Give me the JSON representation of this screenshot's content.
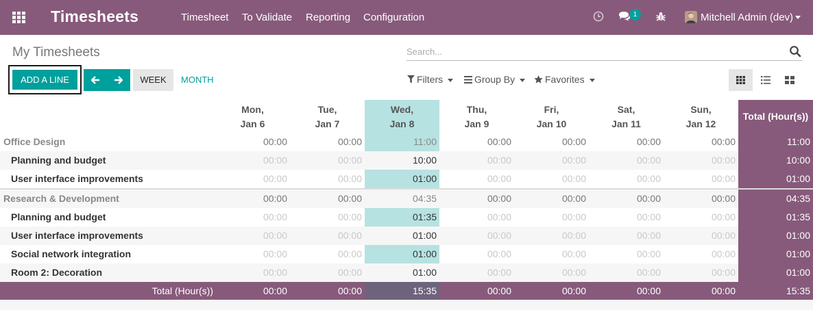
{
  "navbar": {
    "app_title": "Timesheets",
    "menu": [
      "Timesheet",
      "To Validate",
      "Reporting",
      "Configuration"
    ],
    "chat_count": "1",
    "user_name": "Mitchell Admin (dev)",
    "icons": [
      "apps-grid-icon",
      "clock-icon",
      "chat-icon",
      "bug-icon",
      "avatar"
    ],
    "color": "#875a7b"
  },
  "control": {
    "page_title": "My Timesheets",
    "search_placeholder": "Search...",
    "add_line": "ADD A LINE",
    "week": "WEEK",
    "month": "MONTH",
    "filters": "Filters",
    "group_by": "Group By",
    "favorites": "Favorites",
    "accent": "#00a09d"
  },
  "grid": {
    "days": [
      {
        "name": "Mon,",
        "date": "Jan 6"
      },
      {
        "name": "Tue,",
        "date": "Jan 7"
      },
      {
        "name": "Wed,",
        "date": "Jan 8"
      },
      {
        "name": "Thu,",
        "date": "Jan 9"
      },
      {
        "name": "Fri,",
        "date": "Jan 10"
      },
      {
        "name": "Sat,",
        "date": "Jan 11"
      },
      {
        "name": "Sun,",
        "date": "Jan 12"
      }
    ],
    "total_header": "Total (Hour(s))",
    "today_index": 2,
    "rows": [
      {
        "kind": "group",
        "label": "Office Design",
        "values": [
          "00:00",
          "00:00",
          "11:00",
          "00:00",
          "00:00",
          "00:00",
          "00:00"
        ],
        "total": "11:00"
      },
      {
        "kind": "line",
        "label": "Planning and budget",
        "values": [
          "00:00",
          "00:00",
          "10:00",
          "00:00",
          "00:00",
          "00:00",
          "00:00"
        ],
        "total": "10:00"
      },
      {
        "kind": "line",
        "label": "User interface improvements",
        "values": [
          "00:00",
          "00:00",
          "01:00",
          "00:00",
          "00:00",
          "00:00",
          "00:00"
        ],
        "total": "01:00"
      },
      {
        "kind": "group",
        "label": "Research & Development",
        "values": [
          "00:00",
          "00:00",
          "04:35",
          "00:00",
          "00:00",
          "00:00",
          "00:00"
        ],
        "total": "04:35"
      },
      {
        "kind": "line",
        "label": "Planning and budget",
        "values": [
          "00:00",
          "00:00",
          "01:35",
          "00:00",
          "00:00",
          "00:00",
          "00:00"
        ],
        "total": "01:35"
      },
      {
        "kind": "line",
        "label": "User interface improvements",
        "values": [
          "00:00",
          "00:00",
          "01:00",
          "00:00",
          "00:00",
          "00:00",
          "00:00"
        ],
        "total": "01:00"
      },
      {
        "kind": "line",
        "label": "Social network integration",
        "values": [
          "00:00",
          "00:00",
          "01:00",
          "00:00",
          "00:00",
          "00:00",
          "00:00"
        ],
        "total": "01:00"
      },
      {
        "kind": "line",
        "label": "Room 2: Decoration",
        "values": [
          "00:00",
          "00:00",
          "01:00",
          "00:00",
          "00:00",
          "00:00",
          "00:00"
        ],
        "total": "01:00"
      }
    ],
    "footer": {
      "label": "Total (Hour(s))",
      "values": [
        "00:00",
        "00:00",
        "15:35",
        "00:00",
        "00:00",
        "00:00",
        "00:00"
      ],
      "total": "15:35"
    }
  }
}
